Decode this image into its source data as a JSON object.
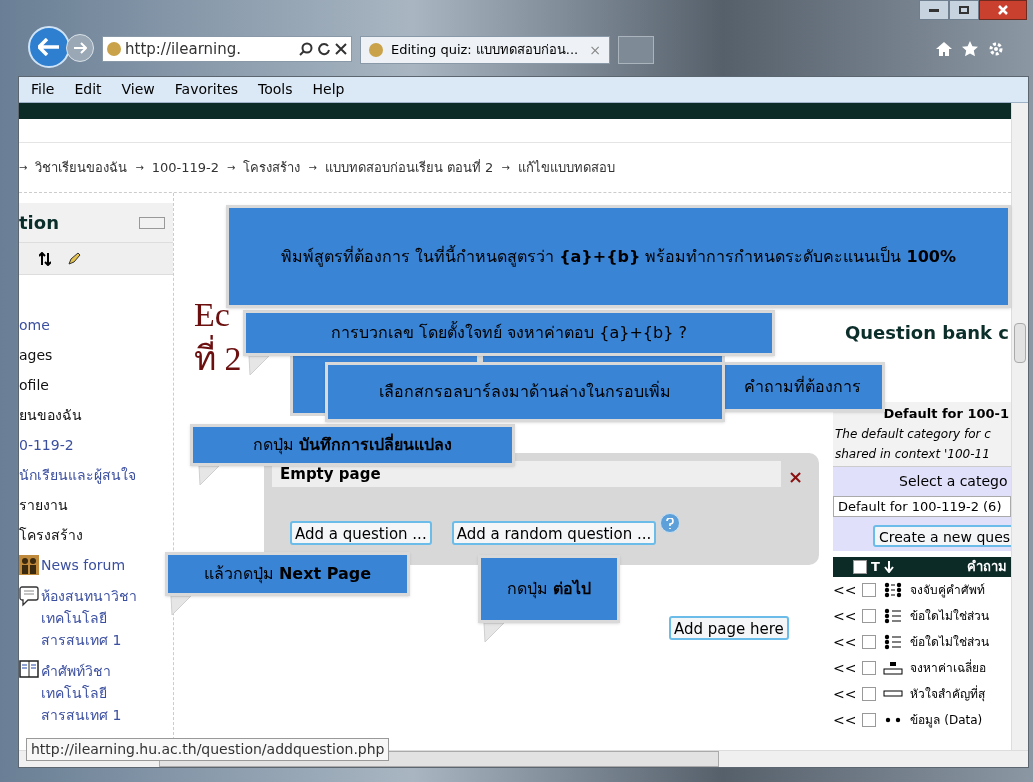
{
  "browser": {
    "address": "http://ilearning.",
    "tab_title": "Editing quiz: แบบทดสอบก่อน...",
    "tab_close": "×",
    "menu": [
      "File",
      "Edit",
      "View",
      "Favorites",
      "Tools",
      "Help"
    ]
  },
  "breadcrumb": {
    "separator": "→",
    "items": [
      "วิชาเรียนของฉัน",
      "100-119-2",
      "โครงสร้าง",
      "แบบทดสอบก่อนเรียน ตอนที่ 2",
      "แก้ไขแบบทดสอบ"
    ]
  },
  "sidebar": {
    "title": "tion",
    "items": [
      {
        "label": "ome",
        "kind": "link"
      },
      {
        "label": "ages",
        "kind": "text"
      },
      {
        "label": "ofile",
        "kind": "text"
      },
      {
        "label": "ยนของฉัน",
        "kind": "text"
      },
      {
        "label": "0-119-2",
        "kind": "link"
      },
      {
        "label": "นักเรียนและผู้สนใจ",
        "kind": "link"
      },
      {
        "label": "รายงาน",
        "kind": "text"
      },
      {
        "label": "โครงสร้าง",
        "kind": "text"
      },
      {
        "label": "News forum",
        "kind": "forum"
      },
      {
        "label": "ห้องสนทนาวิชา เทคโนโลยี สารสนเทศ 1",
        "kind": "chat"
      },
      {
        "label": "คำศัพท์วิชา เทคโนโลยี สารสนเทศ 1",
        "kind": "glossary"
      }
    ]
  },
  "heading": [
    "Ec",
    "ที่ 2"
  ],
  "page_box": {
    "title": "Empty page",
    "close": "×",
    "buttons": [
      "Add a question ...",
      "Add a random question ..."
    ]
  },
  "add_page_button": "Add page here",
  "question_bank": {
    "title": "Question bank c",
    "category": "Default for 100-1",
    "description": "The default category for c shared in context '100-11",
    "select_label": "Select a catego",
    "select_value": "Default for 100-119-2 (6)",
    "create_button": "Create a new ques",
    "select_all_checked": false,
    "column_type": "T",
    "column_question": "คำถาม",
    "rows": [
      {
        "move": "<<",
        "checked": false,
        "kind": "matching",
        "text": "จงจับคู่คำศัพท์"
      },
      {
        "move": "<<",
        "checked": false,
        "kind": "multichoice",
        "text": "ข้อใดไม่ใช่ส่วน"
      },
      {
        "move": "<<",
        "checked": false,
        "kind": "multichoice",
        "text": "ข้อใดไม่ใช่ส่วน"
      },
      {
        "move": "<<",
        "checked": false,
        "kind": "numerical",
        "text": "จงหาค่าเฉลี่ยอ"
      },
      {
        "move": "<<",
        "checked": false,
        "kind": "shortanswer",
        "text": "หัวใจสำคัญที่สุ"
      },
      {
        "move": "<<",
        "checked": false,
        "kind": "dots",
        "text": "ข้อมูล (Data)"
      }
    ]
  },
  "callouts": [
    "พิมพ์สูตรที่ต้องการ ในที่นี้กำหนดสูตรว่า **{a}+{b}** พร้อมทำการกำหนดระดับคะแนนเป็น  **100%**",
    "การบวกเลข โดยตั้งใจทย์ จงหาค่าตอบ {a}+{b} ?",
    "เลือกสกรอลบาร์ลงมาด้านล่างในกรอบเพิ่ม",
    "คำถามที่ต้องการ",
    "กดปุ่ม  **บันทึกการเปลี่ยนแปลง**",
    "แล้วกดปุ่ม  **Next Page**",
    "กดปุ่ม **ต่อไป**"
  ],
  "status_url": "http://ilearning.hu.ac.th/question/addquestion.php"
}
